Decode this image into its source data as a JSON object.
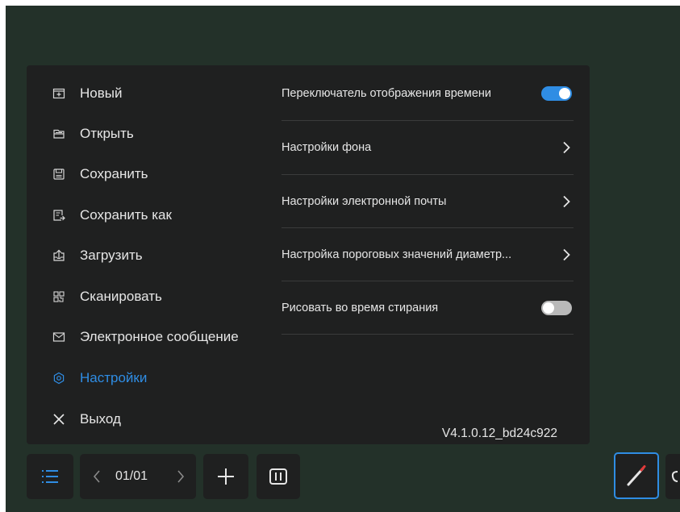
{
  "menu": {
    "items": [
      {
        "label": "Новый",
        "icon": "new-file-icon"
      },
      {
        "label": "Открыть",
        "icon": "open-folder-icon"
      },
      {
        "label": "Сохранить",
        "icon": "save-icon"
      },
      {
        "label": "Сохранить как",
        "icon": "save-as-icon"
      },
      {
        "label": "Загрузить",
        "icon": "upload-icon"
      },
      {
        "label": "Сканировать",
        "icon": "scan-qr-icon"
      },
      {
        "label": "Электронное сообщение",
        "icon": "mail-icon"
      },
      {
        "label": "Настройки",
        "icon": "gear-icon",
        "active": true
      },
      {
        "label": "Выход",
        "icon": "close-icon"
      }
    ]
  },
  "settings": {
    "time_toggle_label": "Переключатель отображения времени",
    "time_toggle_on": true,
    "background_label": "Настройки фона",
    "email_label": "Настройки электронной почты",
    "threshold_label": "Настройка пороговых значений диаметр...",
    "draw_erase_label": "Рисовать во время стирания",
    "draw_erase_on": false,
    "version": "V4.1.0.12_bd24c922"
  },
  "toolbar": {
    "page_indicator": "01/01",
    "menu_icon": "list-menu-icon",
    "add_icon": "plus-icon",
    "pages_icon": "pages-overview-icon",
    "pen_icon": "pen-icon"
  },
  "colors": {
    "accent": "#2f8de4",
    "board": "#233129",
    "panel": "#1f2020"
  }
}
